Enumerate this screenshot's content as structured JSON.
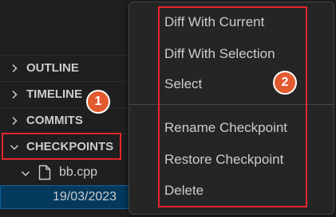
{
  "sidebar": {
    "sections": [
      {
        "label": "OUTLINE",
        "icon": "chevron-right-icon"
      },
      {
        "label": "TIMELINE",
        "icon": "chevron-right-icon"
      },
      {
        "label": "COMMITS",
        "icon": "chevron-right-icon"
      },
      {
        "label": "CHECKPOINTS",
        "icon": "chevron-down-icon"
      }
    ],
    "file": {
      "name": "bb.cpp",
      "icon": "file-icon"
    },
    "checkpoint_entry": "19/03/2023"
  },
  "context_menu": {
    "groups": [
      [
        "Diff With Current",
        "Diff With Selection",
        "Select"
      ],
      [
        "Rename Checkpoint",
        "Restore Checkpoint",
        "Delete"
      ]
    ]
  },
  "annotations": {
    "badge_1": "1",
    "badge_2": "2",
    "highlight_color": "#e8242c",
    "badge_color": "#e25a2f"
  }
}
